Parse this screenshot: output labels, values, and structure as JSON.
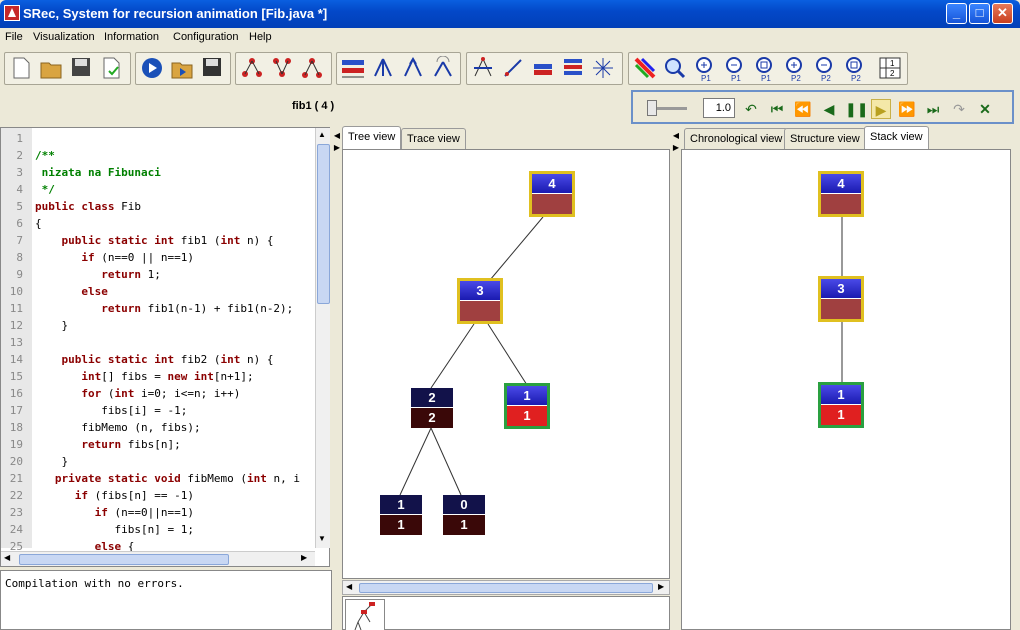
{
  "window": {
    "title": "SRec, System for recursion animation [Fib.java *]"
  },
  "menu": [
    "File",
    "Visualization",
    "Information",
    "Configuration",
    "Help"
  ],
  "toolbar": {
    "icons": [
      "new-file-icon",
      "open-folder-icon",
      "save-icon",
      "save-check-icon",
      "play-icon",
      "open-animation-icon",
      "save-animation-icon",
      "tree-config-icon",
      "tree-config2-icon",
      "tree-nodes-icon",
      "trace-icon",
      "tree-graph-icon",
      "tree-graph2-icon",
      "tree-graph3-icon",
      "trim-icon",
      "trim2-icon",
      "bars-icon",
      "bars2-icon",
      "nodes-icon",
      "colors-icon",
      "search-icon",
      "zoom-in-p1-icon",
      "zoom-out-p1-icon",
      "zoom-fit-p1-icon",
      "zoom-in-p2-icon",
      "zoom-out-p2-icon",
      "zoom-fit-p2-icon",
      "panel-layout-icon"
    ],
    "zoom_labels": [
      "P1",
      "P1",
      "P1",
      "P2",
      "P2",
      "P2"
    ],
    "layout_label_top": "1",
    "layout_label_bot": "2"
  },
  "method_label": "fib1 ( 4 )",
  "animation": {
    "speed": "1.0"
  },
  "editor": {
    "lines": [
      {
        "n": "1",
        "t": ""
      },
      {
        "n": "2",
        "t": "/**"
      },
      {
        "n": "3",
        "t": " nizata na Fibunaci"
      },
      {
        "n": "4",
        "t": " */"
      },
      {
        "n": "5",
        "t": "public class Fib"
      },
      {
        "n": "6",
        "t": "{"
      },
      {
        "n": "7",
        "t": "    public static int fib1 (int n) {"
      },
      {
        "n": "8",
        "t": "       if (n==0 || n==1)"
      },
      {
        "n": "9",
        "t": "          return 1;"
      },
      {
        "n": "10",
        "t": "       else"
      },
      {
        "n": "11",
        "t": "          return fib1(n-1) + fib1(n-2);"
      },
      {
        "n": "12",
        "t": "    }"
      },
      {
        "n": "13",
        "t": ""
      },
      {
        "n": "14",
        "t": "    public static int fib2 (int n) {"
      },
      {
        "n": "15",
        "t": "       int[] fibs = new int[n+1];"
      },
      {
        "n": "16",
        "t": "       for (int i=0; i<=n; i++)"
      },
      {
        "n": "17",
        "t": "          fibs[i] = -1;"
      },
      {
        "n": "18",
        "t": "       fibMemo (n, fibs);"
      },
      {
        "n": "19",
        "t": "       return fibs[n];"
      },
      {
        "n": "20",
        "t": "    }"
      },
      {
        "n": "21",
        "t": "   private static void fibMemo (int n, i"
      },
      {
        "n": "22",
        "t": "      if (fibs[n] == -1)"
      },
      {
        "n": "23",
        "t": "         if (n==0||n==1)"
      },
      {
        "n": "24",
        "t": "            fibs[n] = 1;"
      },
      {
        "n": "25",
        "t": "         else {"
      }
    ]
  },
  "console": {
    "text": "Compilation with no errors."
  },
  "tabs": {
    "left": [
      "Tree view",
      "Trace view"
    ],
    "right": [
      "Chronological view",
      "Structure view",
      "Stack view"
    ]
  },
  "tree": {
    "nodes": [
      {
        "id": "n4",
        "param": "4",
        "result": "",
        "state": "active"
      },
      {
        "id": "n3",
        "param": "3",
        "result": "",
        "state": "active"
      },
      {
        "id": "n2",
        "param": "2",
        "result": "2",
        "state": "old"
      },
      {
        "id": "n1a",
        "param": "1",
        "result": "1",
        "state": "done"
      },
      {
        "id": "n1b",
        "param": "1",
        "result": "1",
        "state": "old"
      },
      {
        "id": "n0",
        "param": "0",
        "result": "1",
        "state": "old"
      }
    ]
  },
  "stack": {
    "nodes": [
      {
        "param": "4",
        "result": "",
        "state": "active"
      },
      {
        "param": "3",
        "result": "",
        "state": "active"
      },
      {
        "param": "1",
        "result": "1",
        "state": "done"
      }
    ]
  }
}
